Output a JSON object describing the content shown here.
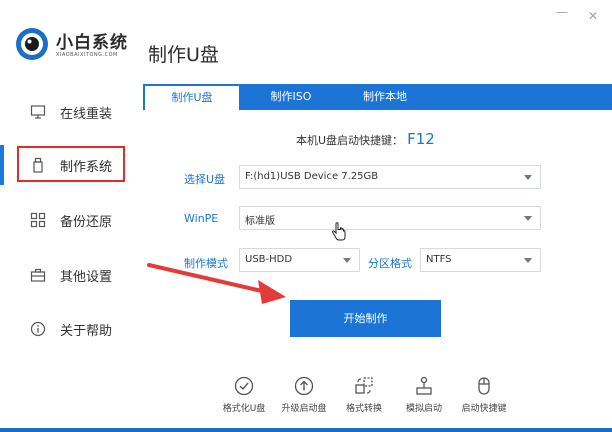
{
  "app": {
    "logo_title": "小白系统",
    "logo_subtitle": "XIAOBAIXITONG.COM",
    "minimize_glyph": "—",
    "close_glyph": "✕"
  },
  "sidebar": {
    "items": [
      {
        "label": "在线重装",
        "icon": "monitor-icon"
      },
      {
        "label": "制作系统",
        "icon": "usb-drive-icon",
        "active": true
      },
      {
        "label": "备份还原",
        "icon": "backup-grid-icon"
      },
      {
        "label": "其他设置",
        "icon": "briefcase-icon"
      },
      {
        "label": "关于帮助",
        "icon": "info-icon"
      }
    ]
  },
  "main": {
    "title": "制作U盘",
    "tabs": [
      {
        "label": "制作U盘",
        "active": true
      },
      {
        "label": "制作ISO"
      },
      {
        "label": "制作本地"
      }
    ],
    "shortcut_label": "本机U盘启动快捷键：",
    "shortcut_key": "F12",
    "form": {
      "usb_label": "选择U盘",
      "usb_value": "F:(hd1)USB Device 7.25GB",
      "winpe_label": "WinPE",
      "winpe_value": "标准版",
      "mode_label": "制作模式",
      "mode_value": "USB-HDD",
      "partition_label": "分区格式",
      "partition_value": "NTFS"
    },
    "start_button": "开始制作"
  },
  "tools": [
    {
      "label": "格式化U盘",
      "icon": "check-circle-icon"
    },
    {
      "label": "升级启动盘",
      "icon": "upload-circle-icon"
    },
    {
      "label": "格式转换",
      "icon": "convert-icon"
    },
    {
      "label": "模拟启动",
      "icon": "joystick-icon"
    },
    {
      "label": "启动快捷键",
      "icon": "mouse-icon"
    }
  ],
  "colors": {
    "accent": "#1b74d6",
    "highlight_box": "#e02d2d",
    "annotation_arrow": "#e53a3a"
  }
}
